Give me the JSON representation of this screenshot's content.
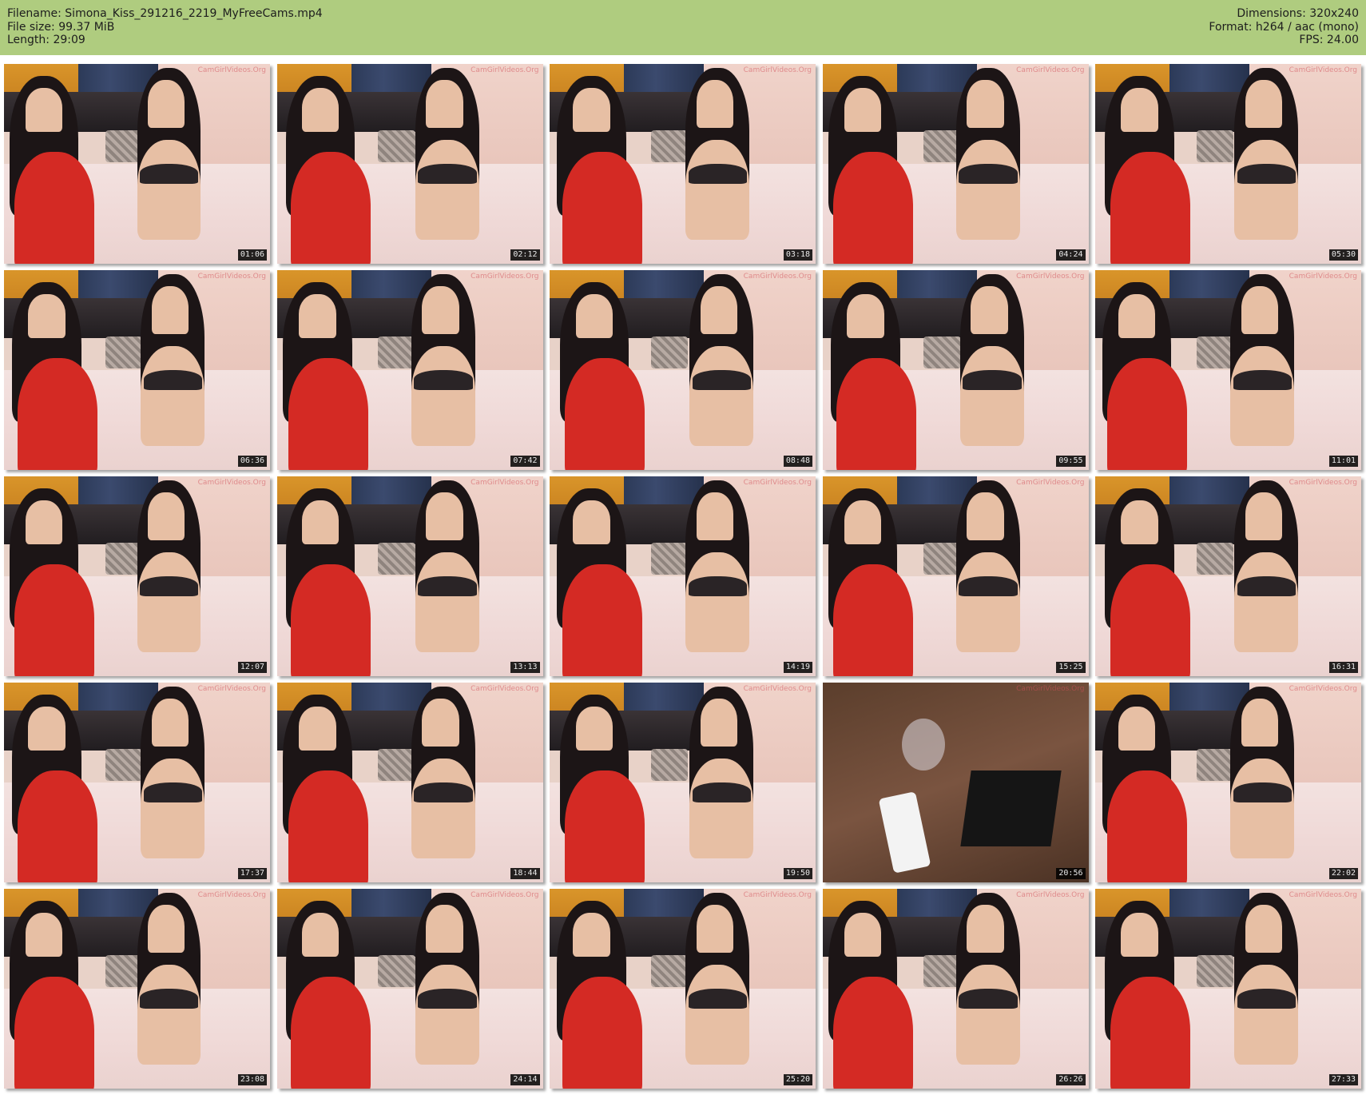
{
  "info": {
    "filename": "Filename: Simona_Kiss_291216_2219_MyFreeCams.mp4",
    "filesize": "File size: 99.37 MiB",
    "length": "Length: 29:09",
    "dimensions": "Dimensions: 320x240",
    "format": "Format: h264 / aac (mono)",
    "fps": "FPS: 24.00"
  },
  "colors": {
    "header_bg": "#afcc7f",
    "timestamp_bg": "#000000"
  },
  "watermark": "CamGirlVideos.Org",
  "thumbnails": [
    {
      "time": "01:06"
    },
    {
      "time": "02:12"
    },
    {
      "time": "03:18"
    },
    {
      "time": "04:24"
    },
    {
      "time": "05:30"
    },
    {
      "time": "06:36"
    },
    {
      "time": "07:42"
    },
    {
      "time": "08:48"
    },
    {
      "time": "09:55"
    },
    {
      "time": "11:01"
    },
    {
      "time": "12:07"
    },
    {
      "time": "13:13"
    },
    {
      "time": "14:19"
    },
    {
      "time": "15:25"
    },
    {
      "time": "16:31"
    },
    {
      "time": "17:37"
    },
    {
      "time": "18:44"
    },
    {
      "time": "19:50"
    },
    {
      "time": "20:56",
      "scene": "desk"
    },
    {
      "time": "22:02"
    },
    {
      "time": "23:08"
    },
    {
      "time": "24:14"
    },
    {
      "time": "25:20"
    },
    {
      "time": "26:26"
    },
    {
      "time": "27:33"
    }
  ]
}
